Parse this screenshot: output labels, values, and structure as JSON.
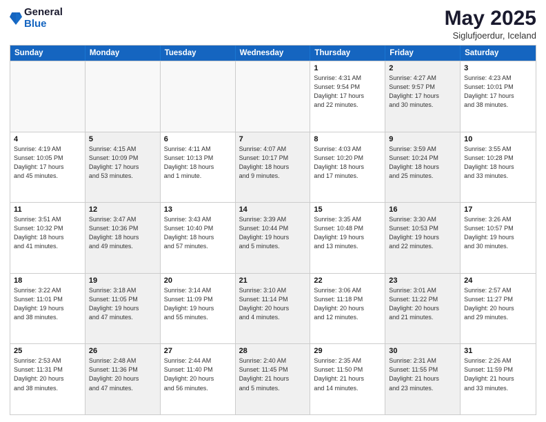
{
  "header": {
    "logo_general": "General",
    "logo_blue": "Blue",
    "month_title": "May 2025",
    "location": "Siglufjoerdur, Iceland"
  },
  "days_of_week": [
    "Sunday",
    "Monday",
    "Tuesday",
    "Wednesday",
    "Thursday",
    "Friday",
    "Saturday"
  ],
  "weeks": [
    [
      {
        "day": "",
        "info": "",
        "empty": true
      },
      {
        "day": "",
        "info": "",
        "empty": true
      },
      {
        "day": "",
        "info": "",
        "empty": true
      },
      {
        "day": "",
        "info": "",
        "empty": true
      },
      {
        "day": "1",
        "info": "Sunrise: 4:31 AM\nSunset: 9:54 PM\nDaylight: 17 hours\nand 22 minutes.",
        "shaded": false
      },
      {
        "day": "2",
        "info": "Sunrise: 4:27 AM\nSunset: 9:57 PM\nDaylight: 17 hours\nand 30 minutes.",
        "shaded": true
      },
      {
        "day": "3",
        "info": "Sunrise: 4:23 AM\nSunset: 10:01 PM\nDaylight: 17 hours\nand 38 minutes.",
        "shaded": false
      }
    ],
    [
      {
        "day": "4",
        "info": "Sunrise: 4:19 AM\nSunset: 10:05 PM\nDaylight: 17 hours\nand 45 minutes.",
        "shaded": false
      },
      {
        "day": "5",
        "info": "Sunrise: 4:15 AM\nSunset: 10:09 PM\nDaylight: 17 hours\nand 53 minutes.",
        "shaded": true
      },
      {
        "day": "6",
        "info": "Sunrise: 4:11 AM\nSunset: 10:13 PM\nDaylight: 18 hours\nand 1 minute.",
        "shaded": false
      },
      {
        "day": "7",
        "info": "Sunrise: 4:07 AM\nSunset: 10:17 PM\nDaylight: 18 hours\nand 9 minutes.",
        "shaded": true
      },
      {
        "day": "8",
        "info": "Sunrise: 4:03 AM\nSunset: 10:20 PM\nDaylight: 18 hours\nand 17 minutes.",
        "shaded": false
      },
      {
        "day": "9",
        "info": "Sunrise: 3:59 AM\nSunset: 10:24 PM\nDaylight: 18 hours\nand 25 minutes.",
        "shaded": true
      },
      {
        "day": "10",
        "info": "Sunrise: 3:55 AM\nSunset: 10:28 PM\nDaylight: 18 hours\nand 33 minutes.",
        "shaded": false
      }
    ],
    [
      {
        "day": "11",
        "info": "Sunrise: 3:51 AM\nSunset: 10:32 PM\nDaylight: 18 hours\nand 41 minutes.",
        "shaded": false
      },
      {
        "day": "12",
        "info": "Sunrise: 3:47 AM\nSunset: 10:36 PM\nDaylight: 18 hours\nand 49 minutes.",
        "shaded": true
      },
      {
        "day": "13",
        "info": "Sunrise: 3:43 AM\nSunset: 10:40 PM\nDaylight: 18 hours\nand 57 minutes.",
        "shaded": false
      },
      {
        "day": "14",
        "info": "Sunrise: 3:39 AM\nSunset: 10:44 PM\nDaylight: 19 hours\nand 5 minutes.",
        "shaded": true
      },
      {
        "day": "15",
        "info": "Sunrise: 3:35 AM\nSunset: 10:48 PM\nDaylight: 19 hours\nand 13 minutes.",
        "shaded": false
      },
      {
        "day": "16",
        "info": "Sunrise: 3:30 AM\nSunset: 10:53 PM\nDaylight: 19 hours\nand 22 minutes.",
        "shaded": true
      },
      {
        "day": "17",
        "info": "Sunrise: 3:26 AM\nSunset: 10:57 PM\nDaylight: 19 hours\nand 30 minutes.",
        "shaded": false
      }
    ],
    [
      {
        "day": "18",
        "info": "Sunrise: 3:22 AM\nSunset: 11:01 PM\nDaylight: 19 hours\nand 38 minutes.",
        "shaded": false
      },
      {
        "day": "19",
        "info": "Sunrise: 3:18 AM\nSunset: 11:05 PM\nDaylight: 19 hours\nand 47 minutes.",
        "shaded": true
      },
      {
        "day": "20",
        "info": "Sunrise: 3:14 AM\nSunset: 11:09 PM\nDaylight: 19 hours\nand 55 minutes.",
        "shaded": false
      },
      {
        "day": "21",
        "info": "Sunrise: 3:10 AM\nSunset: 11:14 PM\nDaylight: 20 hours\nand 4 minutes.",
        "shaded": true
      },
      {
        "day": "22",
        "info": "Sunrise: 3:06 AM\nSunset: 11:18 PM\nDaylight: 20 hours\nand 12 minutes.",
        "shaded": false
      },
      {
        "day": "23",
        "info": "Sunrise: 3:01 AM\nSunset: 11:22 PM\nDaylight: 20 hours\nand 21 minutes.",
        "shaded": true
      },
      {
        "day": "24",
        "info": "Sunrise: 2:57 AM\nSunset: 11:27 PM\nDaylight: 20 hours\nand 29 minutes.",
        "shaded": false
      }
    ],
    [
      {
        "day": "25",
        "info": "Sunrise: 2:53 AM\nSunset: 11:31 PM\nDaylight: 20 hours\nand 38 minutes.",
        "shaded": false
      },
      {
        "day": "26",
        "info": "Sunrise: 2:48 AM\nSunset: 11:36 PM\nDaylight: 20 hours\nand 47 minutes.",
        "shaded": true
      },
      {
        "day": "27",
        "info": "Sunrise: 2:44 AM\nSunset: 11:40 PM\nDaylight: 20 hours\nand 56 minutes.",
        "shaded": false
      },
      {
        "day": "28",
        "info": "Sunrise: 2:40 AM\nSunset: 11:45 PM\nDaylight: 21 hours\nand 5 minutes.",
        "shaded": true
      },
      {
        "day": "29",
        "info": "Sunrise: 2:35 AM\nSunset: 11:50 PM\nDaylight: 21 hours\nand 14 minutes.",
        "shaded": false
      },
      {
        "day": "30",
        "info": "Sunrise: 2:31 AM\nSunset: 11:55 PM\nDaylight: 21 hours\nand 23 minutes.",
        "shaded": true
      },
      {
        "day": "31",
        "info": "Sunrise: 2:26 AM\nSunset: 11:59 PM\nDaylight: 21 hours\nand 33 minutes.",
        "shaded": false
      }
    ]
  ]
}
